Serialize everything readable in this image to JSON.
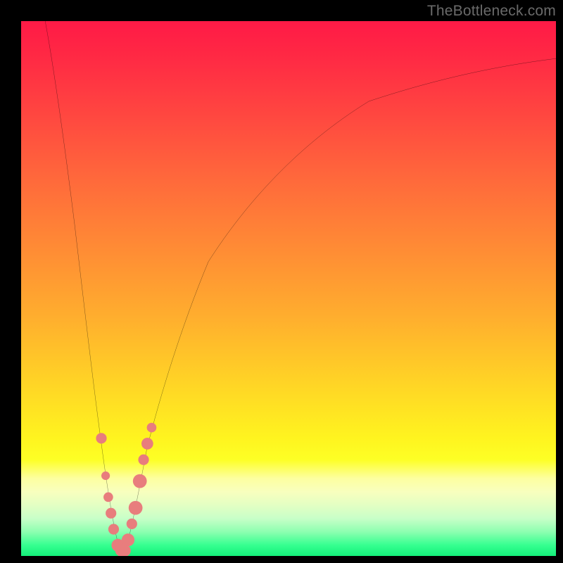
{
  "watermark": "TheBottleneck.com",
  "chart_data": {
    "type": "line",
    "title": "",
    "xlabel": "",
    "ylabel": "",
    "xlim": [
      0,
      100
    ],
    "ylim": [
      0,
      100
    ],
    "legend": false,
    "grid": false,
    "background": {
      "kind": "vertical-gradient",
      "stops": [
        {
          "pos": 0.0,
          "color": "#ff1a46"
        },
        {
          "pos": 0.07,
          "color": "#ff2a44"
        },
        {
          "pos": 0.18,
          "color": "#ff4840"
        },
        {
          "pos": 0.3,
          "color": "#ff6a3b"
        },
        {
          "pos": 0.42,
          "color": "#ff8a35"
        },
        {
          "pos": 0.55,
          "color": "#ffad2e"
        },
        {
          "pos": 0.67,
          "color": "#ffd226"
        },
        {
          "pos": 0.78,
          "color": "#fff41f"
        },
        {
          "pos": 0.82,
          "color": "#fdff25"
        },
        {
          "pos": 0.855,
          "color": "#fdffa0"
        },
        {
          "pos": 0.88,
          "color": "#f8ffbe"
        },
        {
          "pos": 0.905,
          "color": "#e3ffc3"
        },
        {
          "pos": 0.93,
          "color": "#c8ffc8"
        },
        {
          "pos": 0.955,
          "color": "#8cffb0"
        },
        {
          "pos": 0.98,
          "color": "#35ff90"
        },
        {
          "pos": 1.0,
          "color": "#14f07a"
        }
      ]
    },
    "series": [
      {
        "name": "bottleneck-curve",
        "color": "#000000",
        "points": [
          {
            "x": 4.5,
            "y": 100
          },
          {
            "x": 6.0,
            "y": 92
          },
          {
            "x": 8.0,
            "y": 78
          },
          {
            "x": 10.0,
            "y": 62
          },
          {
            "x": 12.0,
            "y": 45
          },
          {
            "x": 13.5,
            "y": 32
          },
          {
            "x": 15.0,
            "y": 21
          },
          {
            "x": 16.2,
            "y": 12
          },
          {
            "x": 17.2,
            "y": 6
          },
          {
            "x": 18.2,
            "y": 2
          },
          {
            "x": 19.0,
            "y": 0
          },
          {
            "x": 19.8,
            "y": 2
          },
          {
            "x": 20.8,
            "y": 6
          },
          {
            "x": 22.0,
            "y": 12
          },
          {
            "x": 23.5,
            "y": 20
          },
          {
            "x": 26.0,
            "y": 30
          },
          {
            "x": 30.0,
            "y": 43
          },
          {
            "x": 35.0,
            "y": 55
          },
          {
            "x": 42.0,
            "y": 66
          },
          {
            "x": 52.0,
            "y": 77
          },
          {
            "x": 65.0,
            "y": 85
          },
          {
            "x": 80.0,
            "y": 90
          },
          {
            "x": 92.0,
            "y": 92
          },
          {
            "x": 100.0,
            "y": 93
          }
        ]
      }
    ],
    "markers": [
      {
        "x": 15.0,
        "y": 22,
        "r": 1.0,
        "color": "#e87d7d"
      },
      {
        "x": 15.8,
        "y": 15,
        "r": 0.8,
        "color": "#e87d7d"
      },
      {
        "x": 16.3,
        "y": 11,
        "r": 0.9,
        "color": "#e87d7d"
      },
      {
        "x": 16.8,
        "y": 8,
        "r": 1.0,
        "color": "#e87d7d"
      },
      {
        "x": 17.3,
        "y": 5,
        "r": 1.0,
        "color": "#e87d7d"
      },
      {
        "x": 18.1,
        "y": 2,
        "r": 1.2,
        "color": "#e87d7d"
      },
      {
        "x": 18.7,
        "y": 1,
        "r": 1.1,
        "color": "#e87d7d"
      },
      {
        "x": 19.4,
        "y": 1,
        "r": 1.1,
        "color": "#e87d7d"
      },
      {
        "x": 20.0,
        "y": 3,
        "r": 1.2,
        "color": "#e87d7d"
      },
      {
        "x": 20.7,
        "y": 6,
        "r": 1.0,
        "color": "#e87d7d"
      },
      {
        "x": 21.4,
        "y": 9,
        "r": 1.3,
        "color": "#e87d7d"
      },
      {
        "x": 22.2,
        "y": 14,
        "r": 1.3,
        "color": "#e87d7d"
      },
      {
        "x": 22.9,
        "y": 18,
        "r": 1.0,
        "color": "#e87d7d"
      },
      {
        "x": 23.6,
        "y": 21,
        "r": 1.1,
        "color": "#e87d7d"
      },
      {
        "x": 24.4,
        "y": 24,
        "r": 0.9,
        "color": "#e87d7d"
      }
    ]
  }
}
